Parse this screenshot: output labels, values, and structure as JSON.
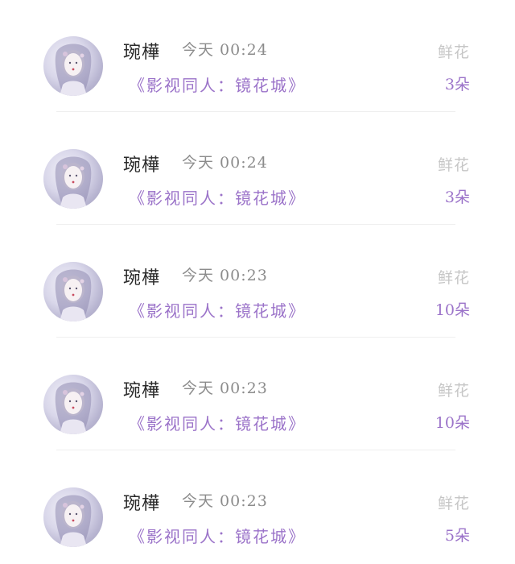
{
  "gift_list": {
    "items": [
      {
        "user": "琬樺",
        "time": "今天 00:24",
        "book": "《影视同人：镜花城》",
        "gift_type": "鲜花",
        "count": "3朵"
      },
      {
        "user": "琬樺",
        "time": "今天 00:24",
        "book": "《影视同人：镜花城》",
        "gift_type": "鲜花",
        "count": "3朵"
      },
      {
        "user": "琬樺",
        "time": "今天 00:23",
        "book": "《影视同人：镜花城》",
        "gift_type": "鲜花",
        "count": "10朵"
      },
      {
        "user": "琬樺",
        "time": "今天 00:23",
        "book": "《影视同人：镜花城》",
        "gift_type": "鲜花",
        "count": "10朵"
      },
      {
        "user": "琬樺",
        "time": "今天 00:23",
        "book": "《影视同人：镜花城》",
        "gift_type": "鲜花",
        "count": "5朵"
      }
    ]
  },
  "colors": {
    "book_title": "#9b73c9",
    "count": "#9b73c9",
    "gift_type": "#c6c6c6",
    "time": "#8c8c8c",
    "user": "#2a2a2a"
  },
  "icons": {
    "avatar": "user-avatar-illustration"
  }
}
